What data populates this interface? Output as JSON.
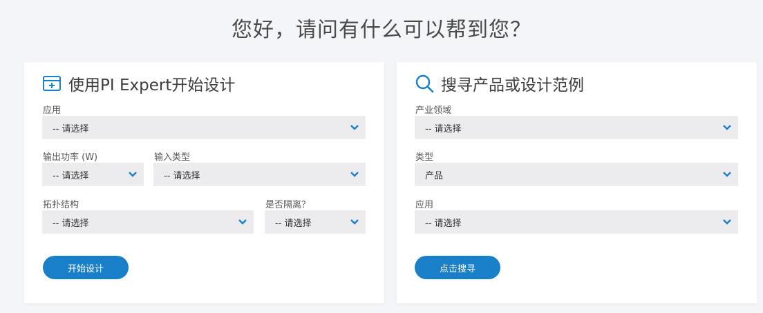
{
  "page": {
    "title": "您好，请问有什么可以帮到您？"
  },
  "colors": {
    "accent": "#1a7fc9",
    "select_bg": "#ececef",
    "page_bg": "#f4f5f8"
  },
  "left_card": {
    "title": "使用PI Expert开始设计",
    "icon": "design-panel-icon",
    "fields": {
      "application": {
        "label": "应用",
        "value": "-- 请选择"
      },
      "output_power": {
        "label": "输出功率 (W)",
        "value": "-- 请选择"
      },
      "input_type": {
        "label": "输入类型",
        "value": "-- 请选择"
      },
      "topology": {
        "label": "拓扑结构",
        "value": "-- 请选择"
      },
      "isolated": {
        "label": "是否隔离？",
        "value": "-- 请选择"
      }
    },
    "button_label": "开始设计"
  },
  "right_card": {
    "title": "搜寻产品或设计范例",
    "icon": "search-icon",
    "fields": {
      "industry": {
        "label": "产业领域",
        "value": "-- 请选择"
      },
      "type": {
        "label": "类型",
        "value": "产品"
      },
      "application": {
        "label": "应用",
        "value": "-- 请选择"
      }
    },
    "button_label": "点击搜寻"
  }
}
